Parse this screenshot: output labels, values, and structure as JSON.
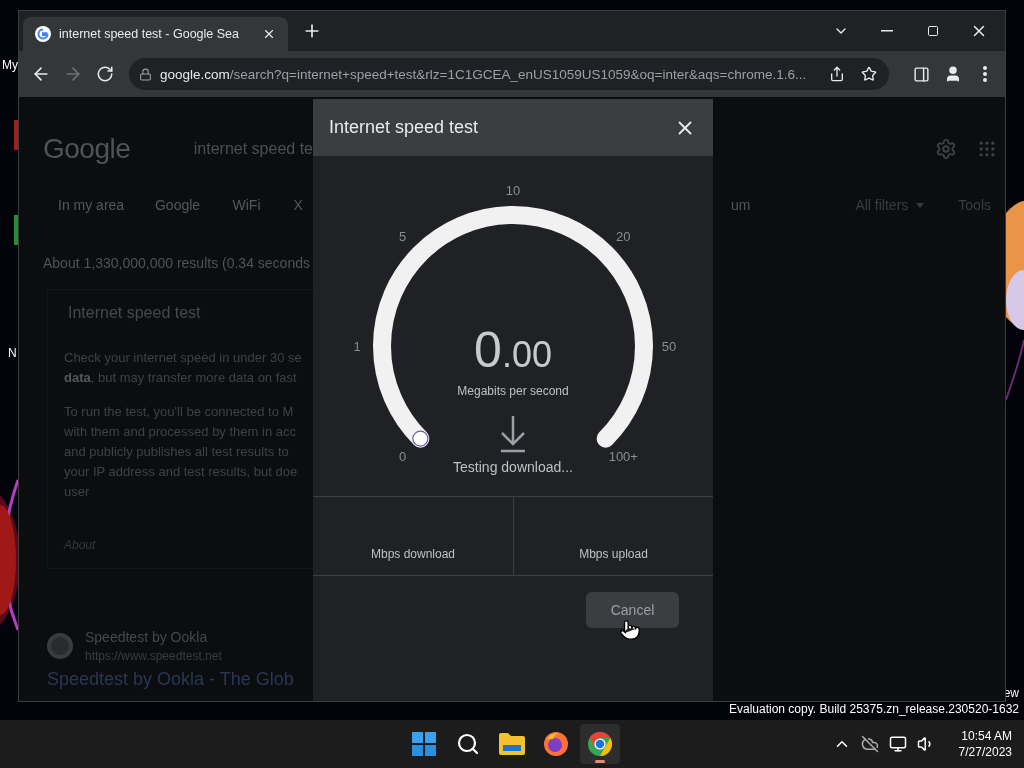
{
  "desktop": {
    "icon_labels": [
      "My",
      "N"
    ],
    "corner_text": "ew",
    "build_notice": "Evaluation copy. Build 25375.zn_release.230520-1632"
  },
  "browser": {
    "tab": {
      "title": "internet speed test - Google Sea",
      "selected": true
    },
    "forward_disabled": true,
    "address": {
      "host": "google.com",
      "path": "/search?q=internet+speed+test&rlz=1C1GCEA_enUS1059US1059&oq=inter&aqs=chrome.1.6..."
    }
  },
  "page": {
    "logo": "Google",
    "search_query": "internet speed te",
    "filters": [
      "In my area",
      "Google",
      "WiFi",
      "X"
    ],
    "filter_fragment": "um",
    "all_filters": "All filters",
    "tools": "Tools",
    "result_count": "About 1,330,000,000 results (0.34 seconds",
    "card": {
      "title": "Internet speed test",
      "paragraphs": [
        [
          "Check your internet speed in under 30 se",
          "**data**, but may transfer more data on fast"
        ],
        [
          "To run the test, you'll be connected to M",
          "with them and processed by them in acc",
          "and publicly publishes all test results to",
          "your IP address and test results, but doe",
          "user"
        ]
      ],
      "about": "About"
    },
    "result": {
      "site": "Speedtest by Ookla",
      "url": "https://www.speedtest.net",
      "title": "Speedtest by Ookla - The Glob"
    }
  },
  "dialog": {
    "title": "Internet speed test",
    "gauge": {
      "ticks": [
        "0",
        "1",
        "5",
        "10",
        "20",
        "50",
        "100+"
      ],
      "reading_whole": "0",
      "reading_fraction": ".00",
      "unit": "Megabits per second",
      "status": "Testing download..."
    },
    "stats": [
      "Mbps download",
      "Mbps upload"
    ],
    "cancel": "Cancel"
  },
  "taskbar": {
    "apps": [
      {
        "kind": "start",
        "selected": false
      },
      {
        "kind": "search",
        "selected": false
      },
      {
        "kind": "files",
        "selected": false
      },
      {
        "kind": "firefox",
        "selected": false
      },
      {
        "kind": "chrome",
        "selected": true
      }
    ],
    "time": "10:54 AM",
    "date": "7/27/2023"
  }
}
